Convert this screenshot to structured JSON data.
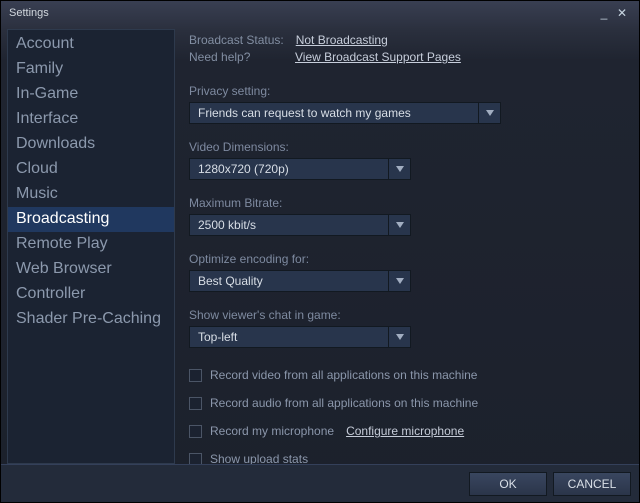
{
  "window": {
    "title": "Settings"
  },
  "sidebar": {
    "items": [
      {
        "label": "Account"
      },
      {
        "label": "Family"
      },
      {
        "label": "In-Game"
      },
      {
        "label": "Interface"
      },
      {
        "label": "Downloads"
      },
      {
        "label": "Cloud"
      },
      {
        "label": "Music"
      },
      {
        "label": "Broadcasting",
        "selected": true
      },
      {
        "label": "Remote Play"
      },
      {
        "label": "Web Browser"
      },
      {
        "label": "Controller"
      },
      {
        "label": "Shader Pre-Caching"
      }
    ]
  },
  "status": {
    "broadcast_label": "Broadcast Status:",
    "broadcast_value": "Not Broadcasting",
    "help_label": "Need help?",
    "help_link": "View Broadcast Support Pages"
  },
  "settings": {
    "privacy": {
      "label": "Privacy setting:",
      "value": "Friends can request to watch my games"
    },
    "dimensions": {
      "label": "Video Dimensions:",
      "value": "1280x720 (720p)"
    },
    "bitrate": {
      "label": "Maximum Bitrate:",
      "value": "2500 kbit/s"
    },
    "encoding": {
      "label": "Optimize encoding for:",
      "value": "Best Quality"
    },
    "chat": {
      "label": "Show viewer's chat in game:",
      "value": "Top-left"
    }
  },
  "checks": {
    "record_video": "Record video from all applications on this machine",
    "record_audio": "Record audio from all applications on this machine",
    "record_mic": "Record my microphone",
    "config_mic": "Configure microphone",
    "upload_stats": "Show upload stats"
  },
  "footer": {
    "ok": "OK",
    "cancel": "CANCEL"
  }
}
